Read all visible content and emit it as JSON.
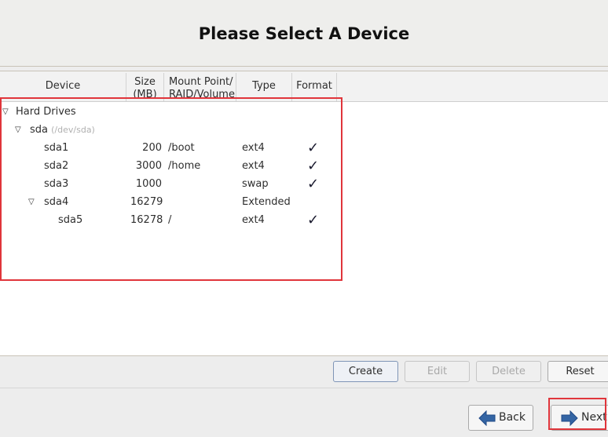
{
  "header": {
    "title": "Please Select A Device"
  },
  "table": {
    "columns": {
      "device": "Device",
      "size_line1": "Size",
      "size_line2": "(MB)",
      "mount_line1": "Mount Point/",
      "mount_line2": "RAID/Volume",
      "type": "Type",
      "format": "Format"
    },
    "tree": {
      "group": "Hard Drives",
      "disk": "sda",
      "disk_path": "(/dev/sda)",
      "rows": [
        {
          "device": "sda1",
          "size": "200",
          "mount": "/boot",
          "type": "ext4",
          "format": "✓"
        },
        {
          "device": "sda2",
          "size": "3000",
          "mount": "/home",
          "type": "ext4",
          "format": "✓"
        },
        {
          "device": "sda3",
          "size": "1000",
          "mount": "",
          "type": "swap",
          "format": "✓"
        },
        {
          "device": "sda4",
          "size": "16279",
          "mount": "",
          "type": "Extended",
          "format": ""
        },
        {
          "device": "sda5",
          "size": "16278",
          "mount": "/",
          "type": "ext4",
          "format": "✓"
        }
      ]
    }
  },
  "actions": {
    "create": "Create",
    "edit": "Edit",
    "delete": "Delete",
    "reset": "Reset"
  },
  "nav": {
    "back": "Back",
    "next": "Next"
  },
  "icons": {
    "expander": "triangle-down-icon",
    "check": "checkmark-icon",
    "back": "arrow-left-icon",
    "next": "arrow-right-icon"
  },
  "colors": {
    "highlight": "#e0353b",
    "arrow_blue": "#3465a4"
  }
}
